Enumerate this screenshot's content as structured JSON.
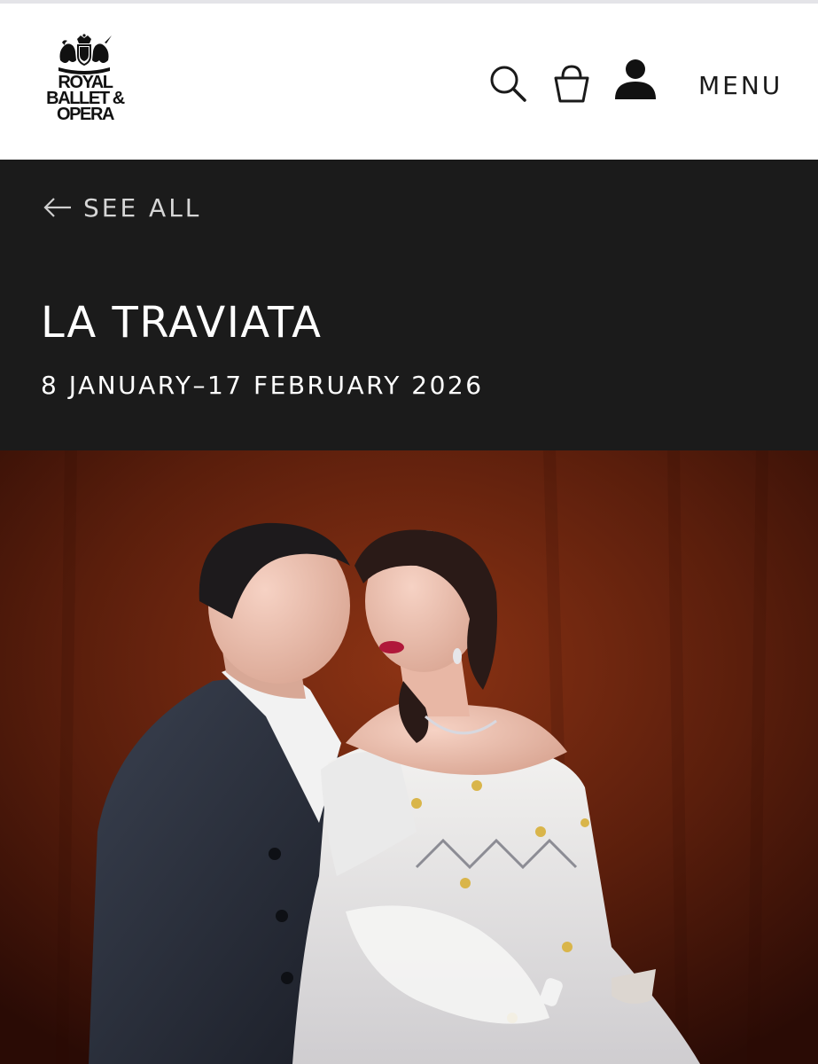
{
  "header": {
    "logo": {
      "lines": [
        "ROYAL",
        "BALLET &",
        "OPERA"
      ],
      "icon": "royal-crest-icon"
    },
    "icons": [
      "search-icon",
      "basket-icon",
      "account-icon"
    ],
    "menu_label": "MENU"
  },
  "banner": {
    "back_label": "SEE ALL",
    "back_icon": "arrow-left-icon",
    "title": "LA TRAVIATA",
    "dates": "8 JANUARY–17 FEBRUARY 2026"
  },
  "hero": {
    "image": "production-photo"
  },
  "colors": {
    "banner_bg": "#1b1b1b",
    "header_bg": "#ffffff",
    "text_light": "#ffffff",
    "text_dark": "#1a1a1a"
  }
}
